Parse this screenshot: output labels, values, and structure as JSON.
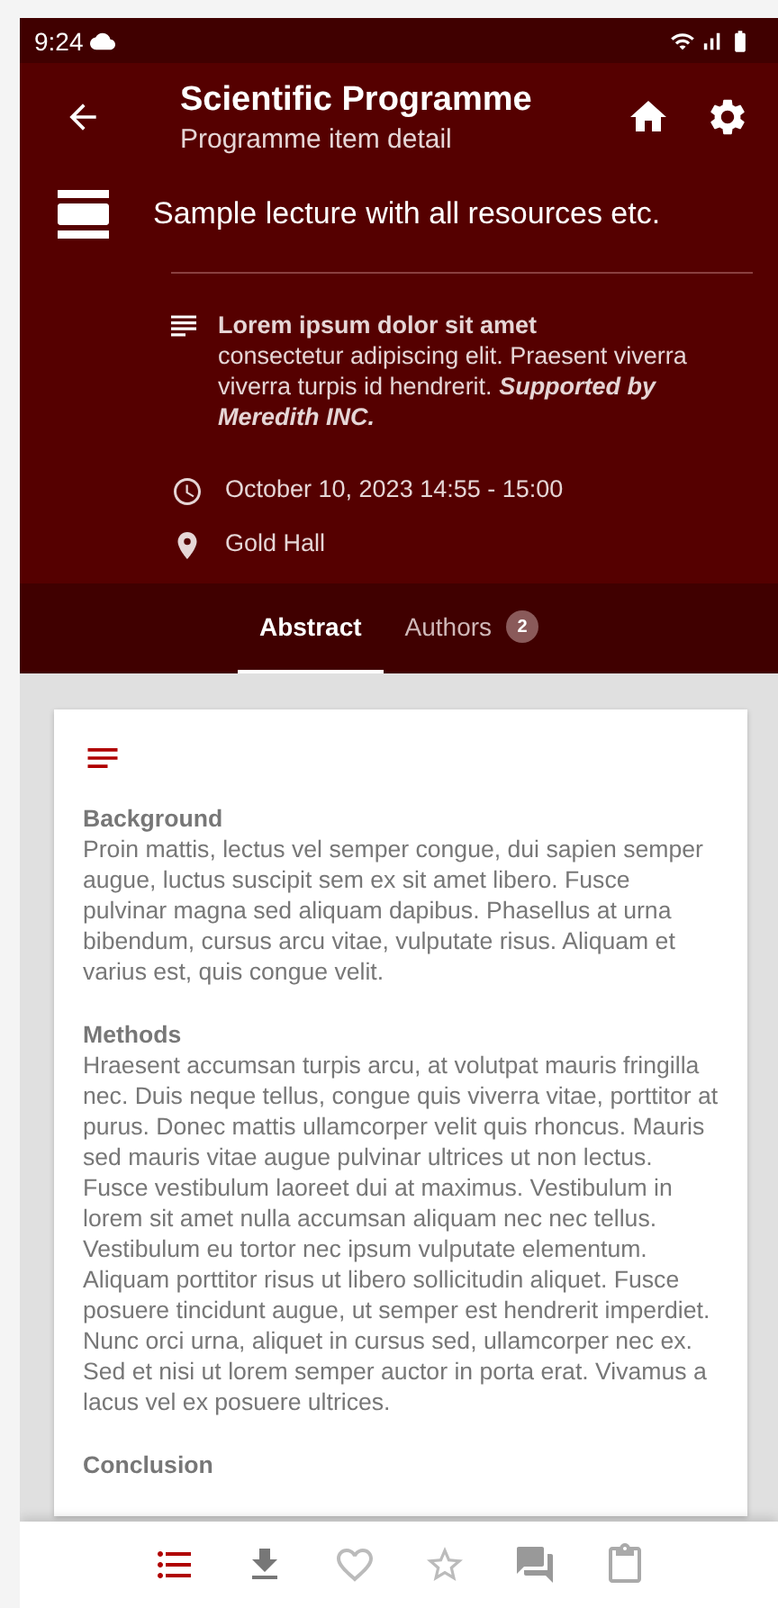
{
  "status_bar": {
    "time": "9:24"
  },
  "app_bar": {
    "title": "Scientific Programme",
    "subtitle": "Programme item detail"
  },
  "item": {
    "title": "Sample lecture with all resources etc.",
    "description_heading": "Lorem ipsum dolor sit amet",
    "description": "consectetur adipiscing elit. Praesent viverra viverra turpis id hendrerit. *Supported by Meredith INC.*",
    "datetime": "October 10, 2023 14:55 - 15:00",
    "location": "Gold Hall"
  },
  "tabs": [
    {
      "label": "Abstract",
      "selected": true
    },
    {
      "label": "Authors",
      "badge": "2",
      "selected": false
    }
  ],
  "abstract": [
    {
      "heading": "Background",
      "text": "Proin mattis, lectus vel semper congue, dui sapien semper augue, luctus suscipit sem ex sit amet libero. Fusce pulvinar magna sed aliquam dapibus. Phasellus at urna bibendum, cursus arcu vitae, vulputate risus. Aliquam et varius est, quis congue velit."
    },
    {
      "heading": "Methods",
      "text": "Hraesent accumsan turpis arcu, at volutpat mauris fringilla nec. Duis neque tellus, congue quis viverra vitae, porttitor at purus. Donec mattis ullamcorper velit quis rhoncus. Mauris sed mauris vitae augue pulvinar ultrices ut non lectus. Fusce vestibulum laoreet dui at maximus. Vestibulum in lorem sit amet nulla accumsan aliquam nec nec tellus. Vestibulum eu tortor nec ipsum vulputate elementum. Aliquam porttitor risus ut libero sollicitudin aliquet. Fusce posuere tincidunt augue, ut semper est hendrerit imperdiet. Nunc orci urna, aliquet in cursus sed, ullamcorper nec ex. Sed et nisi ut lorem semper auctor in porta erat. Vivamus a lacus vel ex posuere ultrices."
    },
    {
      "heading": "Conclusion"
    }
  ],
  "bottom_nav": [
    {
      "kind": "list",
      "selected": true
    },
    {
      "kind": "download",
      "selected": false
    },
    {
      "kind": "heart",
      "selected": false
    },
    {
      "kind": "star",
      "selected": false
    },
    {
      "kind": "chat",
      "selected": false
    },
    {
      "kind": "clipboard",
      "selected": false
    }
  ]
}
